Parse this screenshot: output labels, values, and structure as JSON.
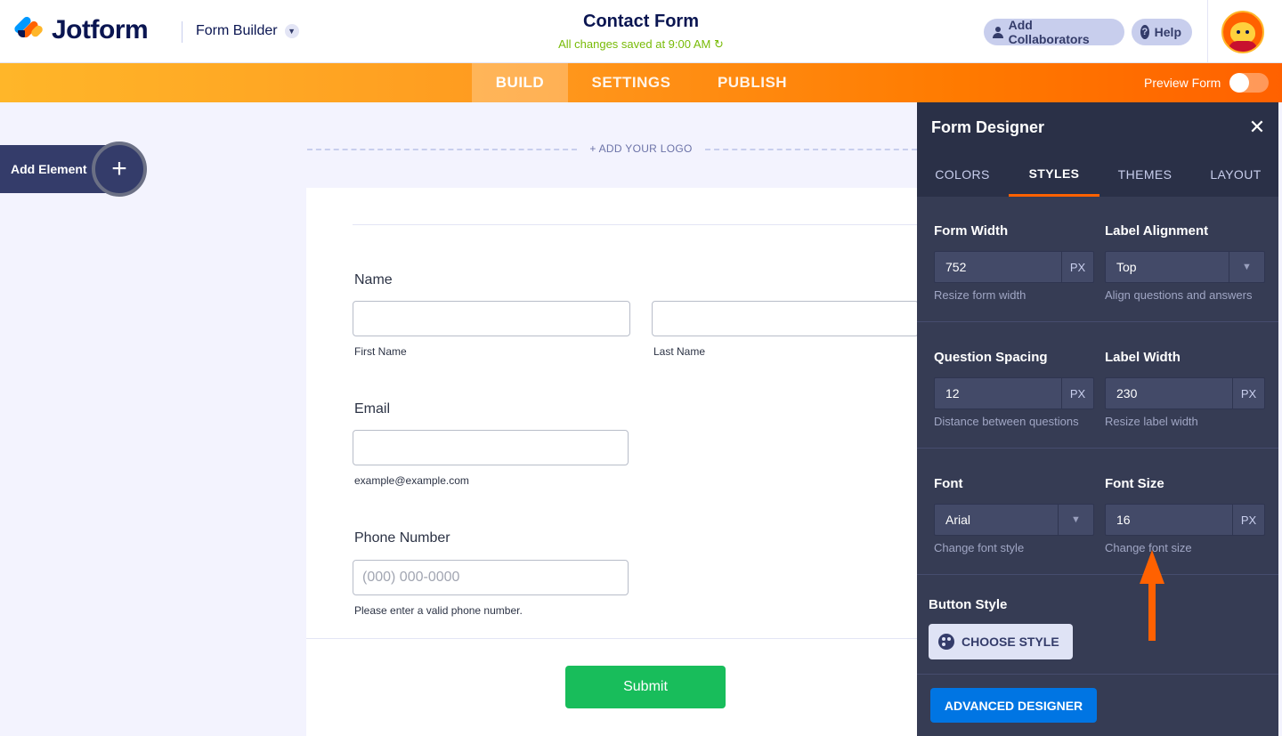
{
  "header": {
    "brand": "Jotform",
    "builder_label": "Form Builder",
    "form_title": "Contact Form",
    "save_status": "All changes saved at 9:00 AM",
    "collab_label": "Add Collaborators",
    "help_label": "Help"
  },
  "nav": {
    "tabs": [
      "BUILD",
      "SETTINGS",
      "PUBLISH"
    ],
    "active": "BUILD",
    "preview_label": "Preview Form",
    "preview_on": false
  },
  "canvas": {
    "add_element_label": "Add Element",
    "add_logo_label": "+ ADD YOUR LOGO",
    "fields": {
      "name_label": "Name",
      "first_name_sub": "First Name",
      "last_name_sub": "Last Name",
      "email_label": "Email",
      "email_sub": "example@example.com",
      "phone_label": "Phone Number",
      "phone_placeholder": "(000) 000-0000",
      "phone_sub": "Please enter a valid phone number."
    },
    "submit_label": "Submit"
  },
  "designer": {
    "title": "Form Designer",
    "tabs": [
      "COLORS",
      "STYLES",
      "THEMES",
      "LAYOUT"
    ],
    "active_tab": "STYLES",
    "form_width": {
      "label": "Form Width",
      "value": "752",
      "unit": "PX",
      "hint": "Resize form width"
    },
    "label_alignment": {
      "label": "Label Alignment",
      "value": "Top",
      "hint": "Align questions and answers"
    },
    "question_spacing": {
      "label": "Question Spacing",
      "value": "12",
      "unit": "PX",
      "hint": "Distance between questions"
    },
    "label_width": {
      "label": "Label Width",
      "value": "230",
      "unit": "PX",
      "hint": "Resize label width"
    },
    "font": {
      "label": "Font",
      "value": "Arial",
      "hint": "Change font style"
    },
    "font_size": {
      "label": "Font Size",
      "value": "16",
      "unit": "PX",
      "hint": "Change font size"
    },
    "button_style_label": "Button Style",
    "choose_style_label": "CHOOSE STYLE",
    "advanced_label": "ADVANCED DESIGNER"
  },
  "colors": {
    "brand_orange": "#ff6100",
    "panel_bg": "#363c54",
    "submit_green": "#18bd5b",
    "advanced_blue": "#0075e3",
    "annotation_arrow": "#ff6100"
  }
}
